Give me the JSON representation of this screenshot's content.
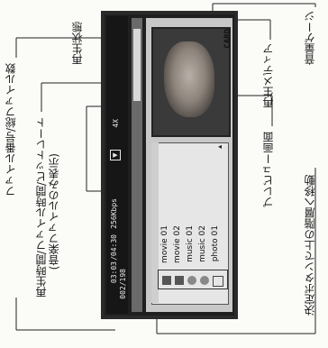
{
  "labels": {
    "file_count": "ファイル番号/総ファイル数",
    "playtime": "再生時間/ファイル時間/ビットレート",
    "playtime_note": "(音楽ファイルのみ表示)",
    "play_state": "再生状態",
    "preview": "プレビュー画面",
    "media": "再生メディア",
    "decision": "決定ボタンで上の階層へ移動",
    "volume": "音量ゲージ"
  },
  "screen": {
    "time": "03:03",
    "duration": "/04:30",
    "bitrate": "256Kbps",
    "file_number": "002/198",
    "speed": "4X",
    "card_label": "CARD"
  },
  "media_list": [
    "movie 01",
    "movie 02",
    "music 01",
    "music 02",
    "photo 01"
  ],
  "colors": {
    "screen_bg": "#2a2a2a",
    "panel_bg": "#c8c8c8",
    "list_bg": "#e6e6e6"
  }
}
